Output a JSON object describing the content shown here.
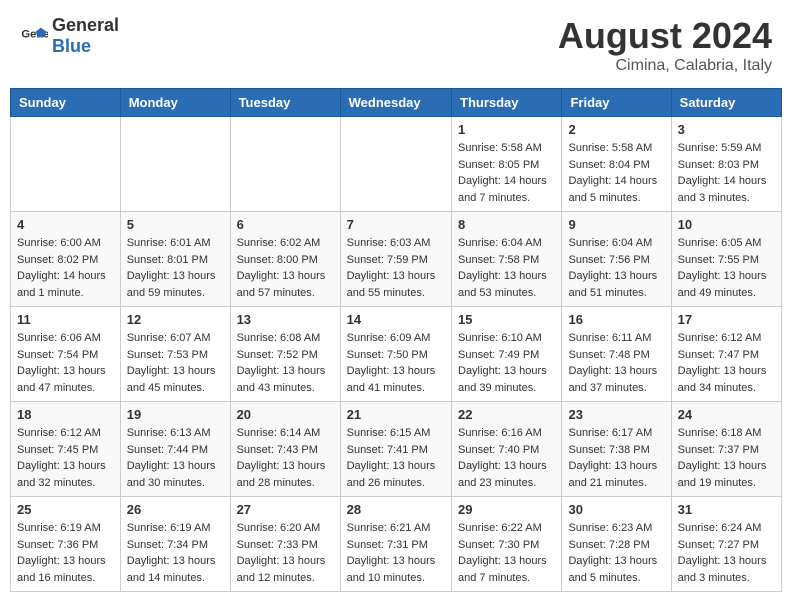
{
  "header": {
    "logo_general": "General",
    "logo_blue": "Blue",
    "main_title": "August 2024",
    "sub_title": "Cimina, Calabria, Italy"
  },
  "weekdays": [
    "Sunday",
    "Monday",
    "Tuesday",
    "Wednesday",
    "Thursday",
    "Friday",
    "Saturday"
  ],
  "weeks": [
    [
      {
        "day": "",
        "info": ""
      },
      {
        "day": "",
        "info": ""
      },
      {
        "day": "",
        "info": ""
      },
      {
        "day": "",
        "info": ""
      },
      {
        "day": "1",
        "info": "Sunrise: 5:58 AM\nSunset: 8:05 PM\nDaylight: 14 hours\nand 7 minutes."
      },
      {
        "day": "2",
        "info": "Sunrise: 5:58 AM\nSunset: 8:04 PM\nDaylight: 14 hours\nand 5 minutes."
      },
      {
        "day": "3",
        "info": "Sunrise: 5:59 AM\nSunset: 8:03 PM\nDaylight: 14 hours\nand 3 minutes."
      }
    ],
    [
      {
        "day": "4",
        "info": "Sunrise: 6:00 AM\nSunset: 8:02 PM\nDaylight: 14 hours\nand 1 minute."
      },
      {
        "day": "5",
        "info": "Sunrise: 6:01 AM\nSunset: 8:01 PM\nDaylight: 13 hours\nand 59 minutes."
      },
      {
        "day": "6",
        "info": "Sunrise: 6:02 AM\nSunset: 8:00 PM\nDaylight: 13 hours\nand 57 minutes."
      },
      {
        "day": "7",
        "info": "Sunrise: 6:03 AM\nSunset: 7:59 PM\nDaylight: 13 hours\nand 55 minutes."
      },
      {
        "day": "8",
        "info": "Sunrise: 6:04 AM\nSunset: 7:58 PM\nDaylight: 13 hours\nand 53 minutes."
      },
      {
        "day": "9",
        "info": "Sunrise: 6:04 AM\nSunset: 7:56 PM\nDaylight: 13 hours\nand 51 minutes."
      },
      {
        "day": "10",
        "info": "Sunrise: 6:05 AM\nSunset: 7:55 PM\nDaylight: 13 hours\nand 49 minutes."
      }
    ],
    [
      {
        "day": "11",
        "info": "Sunrise: 6:06 AM\nSunset: 7:54 PM\nDaylight: 13 hours\nand 47 minutes."
      },
      {
        "day": "12",
        "info": "Sunrise: 6:07 AM\nSunset: 7:53 PM\nDaylight: 13 hours\nand 45 minutes."
      },
      {
        "day": "13",
        "info": "Sunrise: 6:08 AM\nSunset: 7:52 PM\nDaylight: 13 hours\nand 43 minutes."
      },
      {
        "day": "14",
        "info": "Sunrise: 6:09 AM\nSunset: 7:50 PM\nDaylight: 13 hours\nand 41 minutes."
      },
      {
        "day": "15",
        "info": "Sunrise: 6:10 AM\nSunset: 7:49 PM\nDaylight: 13 hours\nand 39 minutes."
      },
      {
        "day": "16",
        "info": "Sunrise: 6:11 AM\nSunset: 7:48 PM\nDaylight: 13 hours\nand 37 minutes."
      },
      {
        "day": "17",
        "info": "Sunrise: 6:12 AM\nSunset: 7:47 PM\nDaylight: 13 hours\nand 34 minutes."
      }
    ],
    [
      {
        "day": "18",
        "info": "Sunrise: 6:12 AM\nSunset: 7:45 PM\nDaylight: 13 hours\nand 32 minutes."
      },
      {
        "day": "19",
        "info": "Sunrise: 6:13 AM\nSunset: 7:44 PM\nDaylight: 13 hours\nand 30 minutes."
      },
      {
        "day": "20",
        "info": "Sunrise: 6:14 AM\nSunset: 7:43 PM\nDaylight: 13 hours\nand 28 minutes."
      },
      {
        "day": "21",
        "info": "Sunrise: 6:15 AM\nSunset: 7:41 PM\nDaylight: 13 hours\nand 26 minutes."
      },
      {
        "day": "22",
        "info": "Sunrise: 6:16 AM\nSunset: 7:40 PM\nDaylight: 13 hours\nand 23 minutes."
      },
      {
        "day": "23",
        "info": "Sunrise: 6:17 AM\nSunset: 7:38 PM\nDaylight: 13 hours\nand 21 minutes."
      },
      {
        "day": "24",
        "info": "Sunrise: 6:18 AM\nSunset: 7:37 PM\nDaylight: 13 hours\nand 19 minutes."
      }
    ],
    [
      {
        "day": "25",
        "info": "Sunrise: 6:19 AM\nSunset: 7:36 PM\nDaylight: 13 hours\nand 16 minutes."
      },
      {
        "day": "26",
        "info": "Sunrise: 6:19 AM\nSunset: 7:34 PM\nDaylight: 13 hours\nand 14 minutes."
      },
      {
        "day": "27",
        "info": "Sunrise: 6:20 AM\nSunset: 7:33 PM\nDaylight: 13 hours\nand 12 minutes."
      },
      {
        "day": "28",
        "info": "Sunrise: 6:21 AM\nSunset: 7:31 PM\nDaylight: 13 hours\nand 10 minutes."
      },
      {
        "day": "29",
        "info": "Sunrise: 6:22 AM\nSunset: 7:30 PM\nDaylight: 13 hours\nand 7 minutes."
      },
      {
        "day": "30",
        "info": "Sunrise: 6:23 AM\nSunset: 7:28 PM\nDaylight: 13 hours\nand 5 minutes."
      },
      {
        "day": "31",
        "info": "Sunrise: 6:24 AM\nSunset: 7:27 PM\nDaylight: 13 hours\nand 3 minutes."
      }
    ]
  ]
}
